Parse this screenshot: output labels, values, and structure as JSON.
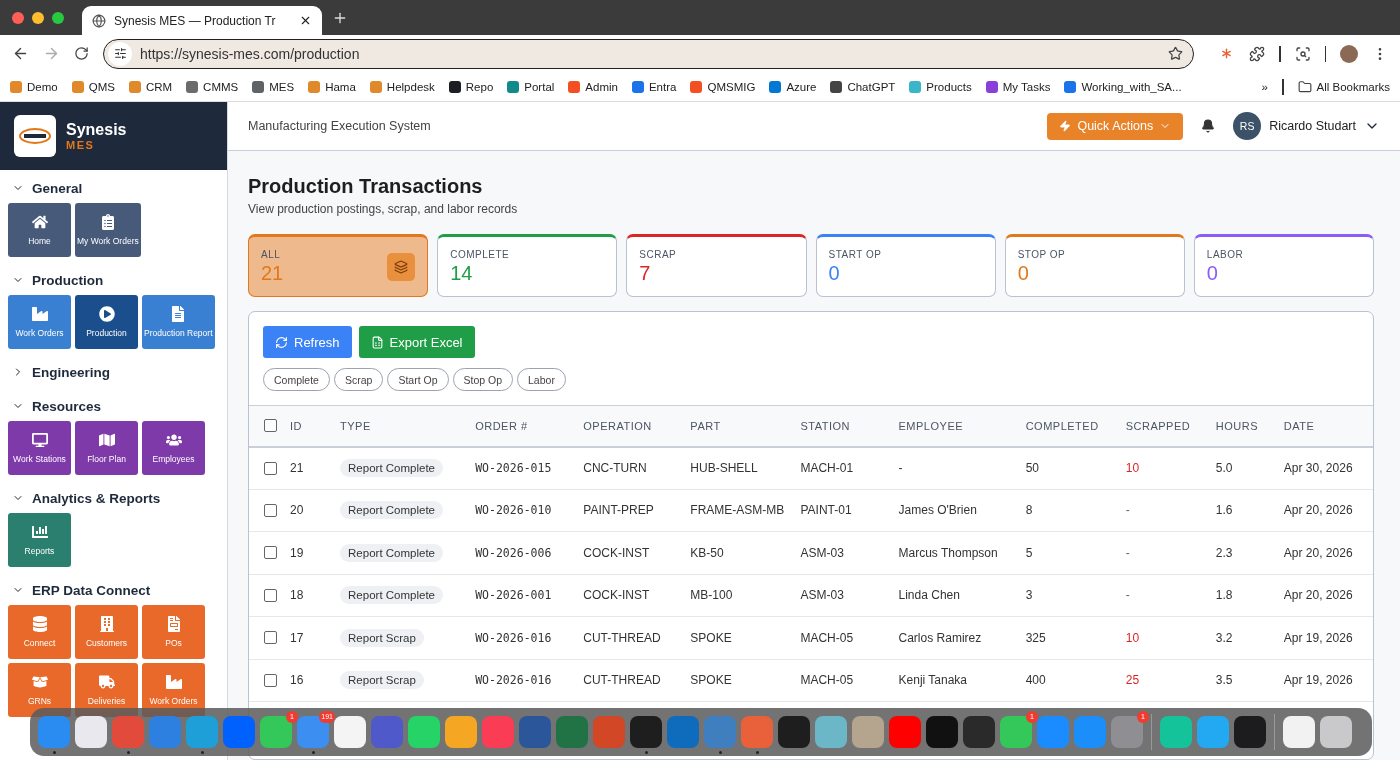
{
  "browser": {
    "tab_title": "Synesis MES — Production Tr",
    "url": "https://synesis-mes.com/production",
    "bookmarks": [
      {
        "label": "Demo",
        "color": "#e0892a"
      },
      {
        "label": "QMS",
        "color": "#e0892a"
      },
      {
        "label": "CRM",
        "color": "#e0892a"
      },
      {
        "label": "CMMS",
        "color": "#6b6b6b"
      },
      {
        "label": "MES",
        "color": "#5f6368"
      },
      {
        "label": "Hama",
        "color": "#e0892a"
      },
      {
        "label": "Helpdesk",
        "color": "#e0892a"
      },
      {
        "label": "Repo",
        "color": "#1b1f23"
      },
      {
        "label": "Portal",
        "color": "#138a8a"
      },
      {
        "label": "Admin",
        "color": "#f25022"
      },
      {
        "label": "Entra",
        "color": "#1a73e8"
      },
      {
        "label": "QMSMIG",
        "color": "#f25022"
      },
      {
        "label": "Azure",
        "color": "#0078d4"
      },
      {
        "label": "ChatGPT",
        "color": "#444444"
      },
      {
        "label": "Products",
        "color": "#3ab5c9"
      },
      {
        "label": "My Tasks",
        "color": "#8b3fd9"
      },
      {
        "label": "Working_with_SA...",
        "color": "#1a73e8"
      }
    ],
    "overflow": "»",
    "all_bookmarks": "All Bookmarks"
  },
  "sidebar": {
    "brand": "Synesis",
    "product": "MES",
    "sections": [
      {
        "title": "General",
        "expanded": true,
        "color": "#475a7a",
        "items": [
          {
            "label": "Home",
            "selected": false
          },
          {
            "label": "My Work Orders",
            "selected": false
          }
        ]
      },
      {
        "title": "Production",
        "expanded": true,
        "color": "#3a80d2",
        "items": [
          {
            "label": "Work Orders",
            "selected": false
          },
          {
            "label": "Production",
            "selected": true
          },
          {
            "label": "Production Report",
            "selected": false
          }
        ]
      },
      {
        "title": "Engineering",
        "expanded": false
      },
      {
        "title": "Resources",
        "expanded": true,
        "color": "#7e3aa9",
        "items": [
          {
            "label": "Work Stations",
            "selected": false
          },
          {
            "label": "Floor Plan",
            "selected": false
          },
          {
            "label": "Employees",
            "selected": false
          }
        ]
      },
      {
        "title": "Analytics & Reports",
        "expanded": true,
        "color": "#2a7f6f",
        "items": [
          {
            "label": "Reports",
            "selected": false
          }
        ]
      },
      {
        "title": "ERP Data Connect",
        "expanded": true,
        "color": "#e8692a",
        "items": [
          {
            "label": "Connect",
            "selected": false
          },
          {
            "label": "Customers",
            "selected": false
          },
          {
            "label": "POs",
            "selected": false
          },
          {
            "label": "GRNs",
            "selected": false
          },
          {
            "label": "Deliveries",
            "selected": false
          },
          {
            "label": "Work Orders",
            "selected": false
          }
        ]
      }
    ]
  },
  "header": {
    "title": "Manufacturing Execution System",
    "quick_actions": "Quick Actions",
    "user_initials": "RS",
    "user_name": "Ricardo Studart"
  },
  "page": {
    "title": "Production Transactions",
    "subtitle": "View production postings, scrap, and labor records"
  },
  "stats": [
    {
      "label": "ALL",
      "value": "21",
      "color": "#e2781c",
      "selected": true
    },
    {
      "label": "COMPLETE",
      "value": "14",
      "color": "#1f9d47",
      "selected": false
    },
    {
      "label": "SCRAP",
      "value": "7",
      "color": "#dc2626",
      "selected": false
    },
    {
      "label": "START OP",
      "value": "0",
      "color": "#3b82f6",
      "selected": false
    },
    {
      "label": "STOP OP",
      "value": "0",
      "color": "#e2781c",
      "selected": false
    },
    {
      "label": "LABOR",
      "value": "0",
      "color": "#8b5cf6",
      "selected": false
    }
  ],
  "actions": {
    "refresh": "Refresh",
    "export": "Export Excel"
  },
  "filters": [
    {
      "label": "Complete",
      "selected": false
    },
    {
      "label": "Scrap",
      "selected": false
    },
    {
      "label": "Start Op",
      "selected": false
    },
    {
      "label": "Stop Op",
      "selected": false
    },
    {
      "label": "Labor",
      "selected": false
    }
  ],
  "table": {
    "select_all": false,
    "columns": [
      "ID",
      "TYPE",
      "ORDER #",
      "OPERATION",
      "PART",
      "STATION",
      "EMPLOYEE",
      "COMPLETED",
      "SCRAPPED",
      "HOURS",
      "DATE"
    ],
    "rows": [
      {
        "checked": false,
        "id": "21",
        "type": "Report Complete",
        "order": "WO-2026-015",
        "operation": "CNC-TURN",
        "part": "HUB-SHELL",
        "station": "MACH-01",
        "employee": "-",
        "completed": "50",
        "scrapped": "10",
        "scrap_flag": true,
        "hours": "5.0",
        "date": "Apr 30, 2026"
      },
      {
        "checked": false,
        "id": "20",
        "type": "Report Complete",
        "order": "WO-2026-010",
        "operation": "PAINT-PREP",
        "part": "FRAME-ASM-MB",
        "station": "PAINT-01",
        "employee": "James O'Brien",
        "completed": "8",
        "scrapped": "-",
        "scrap_flag": false,
        "hours": "1.6",
        "date": "Apr 20, 2026"
      },
      {
        "checked": false,
        "id": "19",
        "type": "Report Complete",
        "order": "WO-2026-006",
        "operation": "COCK-INST",
        "part": "KB-50",
        "station": "ASM-03",
        "employee": "Marcus Thompson",
        "completed": "5",
        "scrapped": "-",
        "scrap_flag": false,
        "hours": "2.3",
        "date": "Apr 20, 2026"
      },
      {
        "checked": false,
        "id": "18",
        "type": "Report Complete",
        "order": "WO-2026-001",
        "operation": "COCK-INST",
        "part": "MB-100",
        "station": "ASM-03",
        "employee": "Linda Chen",
        "completed": "3",
        "scrapped": "-",
        "scrap_flag": false,
        "hours": "1.8",
        "date": "Apr 20, 2026"
      },
      {
        "checked": false,
        "id": "17",
        "type": "Report Scrap",
        "order": "WO-2026-016",
        "operation": "CUT-THREAD",
        "part": "SPOKE",
        "station": "MACH-05",
        "employee": "Carlos Ramirez",
        "completed": "325",
        "scrapped": "10",
        "scrap_flag": true,
        "hours": "3.2",
        "date": "Apr 19, 2026"
      },
      {
        "checked": false,
        "id": "16",
        "type": "Report Scrap",
        "order": "WO-2026-016",
        "operation": "CUT-THREAD",
        "part": "SPOKE",
        "station": "MACH-05",
        "employee": "Kenji Tanaka",
        "completed": "400",
        "scrapped": "25",
        "scrap_flag": true,
        "hours": "3.5",
        "date": "Apr 19, 2026"
      }
    ]
  },
  "dock": {
    "groups": [
      [
        {
          "color": "#2a8cf0",
          "running": true
        },
        {
          "color": "#e8e8ee",
          "running": false
        },
        {
          "color": "#e24b3b",
          "running": true
        },
        {
          "color": "#2d7fe0",
          "running": false
        },
        {
          "color": "#1f9fd8",
          "running": true
        },
        {
          "color": "#0061fe",
          "running": false
        },
        {
          "color": "#34c759",
          "running": false,
          "badge": "1"
        },
        {
          "color": "#3c8ef0",
          "running": true,
          "badge": "191"
        },
        {
          "color": "#f4f4f4",
          "running": false
        },
        {
          "color": "#5059c9",
          "running": false
        },
        {
          "color": "#25d366",
          "running": false
        },
        {
          "color": "#f5a623",
          "running": false
        },
        {
          "color": "#fa3c55",
          "running": false
        },
        {
          "color": "#2b579a",
          "running": false
        },
        {
          "color": "#217346",
          "running": false
        },
        {
          "color": "#d24726",
          "running": false
        },
        {
          "color": "#1e1e1e",
          "running": true
        },
        {
          "color": "#0f6cbd",
          "running": false
        },
        {
          "color": "#3f7fc0",
          "running": true
        },
        {
          "color": "#e8613a",
          "running": true
        },
        {
          "color": "#1e1e1e",
          "running": false
        },
        {
          "color": "#6cb7c7",
          "running": false
        },
        {
          "color": "#b5a58f",
          "running": false
        },
        {
          "color": "#ff0000",
          "running": false
        },
        {
          "color": "#111111",
          "running": false
        },
        {
          "color": "#2a2a2a",
          "running": false
        },
        {
          "color": "#34c759",
          "running": false,
          "badge": "1"
        },
        {
          "color": "#1a8cff",
          "running": false
        },
        {
          "color": "#1c8ef9",
          "running": false
        },
        {
          "color": "#8e8e93",
          "running": false,
          "badge": "1"
        }
      ],
      [
        {
          "color": "#15c39a",
          "running": false
        },
        {
          "color": "#23a9f2",
          "running": false
        },
        {
          "color": "#1c1c1e",
          "running": false
        }
      ],
      [
        {
          "color": "#f2f2f2",
          "running": false
        },
        {
          "color": "#c9c9cc",
          "running": false
        }
      ]
    ]
  }
}
